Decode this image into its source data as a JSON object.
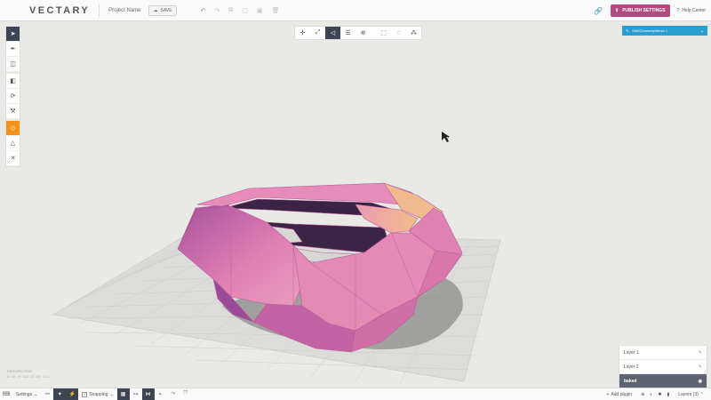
{
  "header": {
    "logo": "VECTARY",
    "project_name": "Project Name",
    "save_label": "SAVE",
    "publish_label": "PUBLISH SETTINGS",
    "help_label": "Help Center"
  },
  "object_selector": {
    "value": "Edit/Geometry/Mesh 1"
  },
  "layers": [
    {
      "label": "Layer 1"
    },
    {
      "label": "Layer 2"
    },
    {
      "label": "baked"
    }
  ],
  "viewport_info": {
    "mode": "PERSPECTIVE",
    "stats": "V: 40 · F: 114 · E: 35 · O: 1"
  },
  "bottom": {
    "settings_label": "Settings",
    "snapping_label": "Snapping",
    "add_plugin_label": "Add plugin",
    "layers_label": "Layers (3)"
  },
  "colors": {
    "accent_publish": "#b24a7e",
    "accent_object": "#2a9fcf",
    "active_tool": "#3f4453",
    "highlight_tool": "#f29317",
    "mesh_pink": "#e58bb6",
    "mesh_purple": "#8a3e90",
    "mesh_peach": "#efb48e"
  },
  "icons": {
    "history": [
      "undo-icon",
      "redo-icon",
      "copy-icon",
      "duplicate-icon",
      "paste-icon",
      "delete-icon"
    ],
    "left_tools": [
      "select-icon",
      "pen-icon",
      "cube-icon",
      "material-icon",
      "transform-icon",
      "hammer-icon",
      "vertex-icon",
      "triangle-icon",
      "scale-icon"
    ],
    "center_tools": [
      "move-icon",
      "scale-arrows-icon",
      "select-face-icon",
      "layers-stack-icon",
      "object-icon",
      "box-select-icon",
      "lasso-icon",
      "magic-select-icon"
    ]
  }
}
